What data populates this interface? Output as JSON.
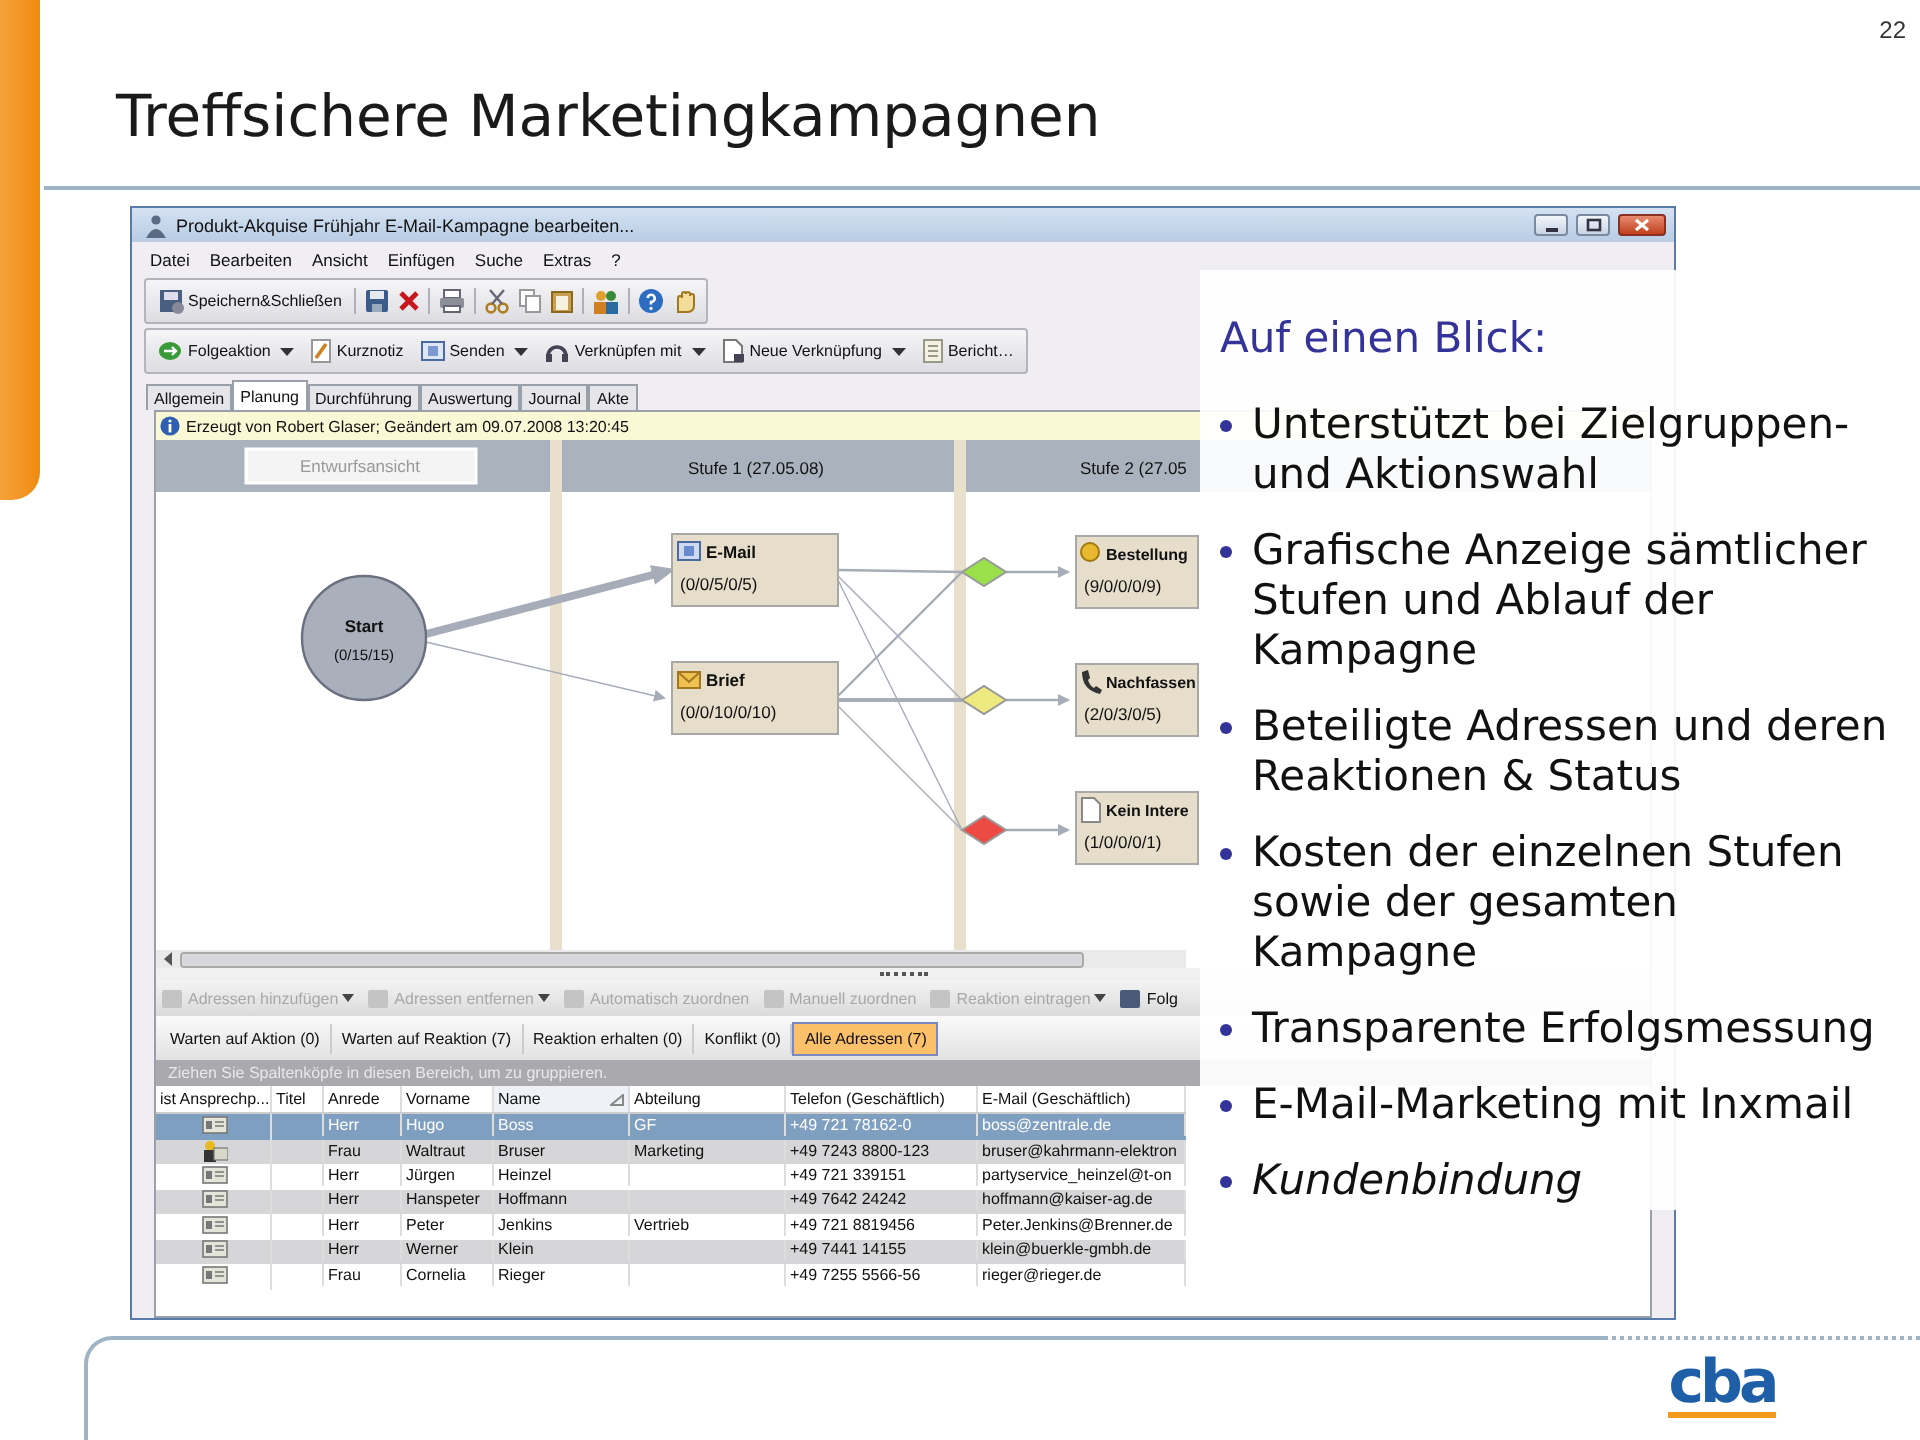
{
  "slide": {
    "page_number": "22",
    "title": "Treffsichere Marketingkampagnen",
    "logo": "cba"
  },
  "window": {
    "title": "Produkt-Akquise Frühjahr E-Mail-Kampagne bearbeiten..."
  },
  "menu": [
    "Datei",
    "Bearbeiten",
    "Ansicht",
    "Einfügen",
    "Suche",
    "Extras",
    "?"
  ],
  "toolbar": {
    "save_label": "Speichern&Schließen"
  },
  "toolbar_2": [
    {
      "label": "Folgeaktion",
      "dropdown": true
    },
    {
      "label": "Kurznotiz",
      "dropdown": false
    },
    {
      "label": "Senden",
      "dropdown": true
    },
    {
      "label": "Verknüpfen mit",
      "dropdown": true
    },
    {
      "label": "Neue Verknüpfung",
      "dropdown": true
    },
    {
      "label": "Bericht…",
      "dropdown": false
    }
  ],
  "tabs": [
    {
      "label": "Allgemein",
      "selected": false
    },
    {
      "label": "Planung",
      "selected": true
    },
    {
      "label": "Durchführung",
      "selected": false
    },
    {
      "label": "Auswertung",
      "selected": false
    },
    {
      "label": "Journal",
      "selected": false
    },
    {
      "label": "Akte",
      "selected": false
    }
  ],
  "info": "Erzeugt von Robert Glaser; Geändert am 09.07.2008 13:20:45",
  "diagram": {
    "view_button": "Entwurfsansicht",
    "stages": [
      "Stufe 1 (27.05.08)",
      "Stufe 2 (27.05"
    ],
    "start": {
      "label": "Start",
      "counts": "(0/15/15)"
    },
    "actions": [
      {
        "label": "E-Mail",
        "counts": "(0/0/5/0/5)"
      },
      {
        "label": "Brief",
        "counts": "(0/0/10/0/10)"
      }
    ],
    "decisions": [
      {
        "color": "#99e04a"
      },
      {
        "color": "#eeea80"
      },
      {
        "color": "#ee4a44"
      }
    ],
    "results": [
      {
        "label": "Bestellung",
        "counts": "(9/0/0/0/9)"
      },
      {
        "label": "Nachfassen",
        "counts": "(2/0/3/0/5)"
      },
      {
        "label": "Kein Intere",
        "counts": "(1/0/0/0/1)"
      }
    ]
  },
  "actions_bar": [
    {
      "label": "Adressen hinzufügen",
      "disabled": true,
      "dropdown": true
    },
    {
      "label": "Adressen entfernen",
      "disabled": true,
      "dropdown": true
    },
    {
      "label": "Automatisch zuordnen",
      "disabled": true,
      "dropdown": false
    },
    {
      "label": "Manuell zuordnen",
      "disabled": true,
      "dropdown": false
    },
    {
      "label": "Reaktion eintragen",
      "disabled": true,
      "dropdown": true
    },
    {
      "label": "Folg",
      "disabled": false,
      "dropdown": false
    }
  ],
  "filters": [
    {
      "label": "Warten auf Aktion (0)",
      "selected": false
    },
    {
      "label": "Warten auf Reaktion (7)",
      "selected": false
    },
    {
      "label": "Reaktion erhalten (0)",
      "selected": false
    },
    {
      "label": "Konflikt (0)",
      "selected": false
    },
    {
      "label": "Alle Adressen (7)",
      "selected": true
    }
  ],
  "group_hint": "Ziehen Sie Spaltenköpfe in diesen Bereich, um zu gruppieren.",
  "table": {
    "columns": [
      {
        "label": "ist Ansprechp...",
        "sorted": false
      },
      {
        "label": "Titel",
        "sorted": false
      },
      {
        "label": "Anrede",
        "sorted": false
      },
      {
        "label": "Vorname",
        "sorted": false
      },
      {
        "label": "Name",
        "sorted": true
      },
      {
        "label": "Abteilung",
        "sorted": false
      },
      {
        "label": "Telefon (Geschäftlich)",
        "sorted": false
      },
      {
        "label": "E-Mail (Geschäftlich)",
        "sorted": false
      }
    ],
    "rows": [
      {
        "selected": true,
        "is_contact": false,
        "anrede": "Herr",
        "vorname": "Hugo",
        "name": "Boss",
        "abteilung": "GF",
        "telefon": "+49 721 78162-0",
        "email": "boss@zentrale.de"
      },
      {
        "selected": false,
        "is_contact": true,
        "anrede": "Frau",
        "vorname": "Waltraut",
        "name": "Bruser",
        "abteilung": "Marketing",
        "telefon": "+49 7243 8800-123",
        "email": "bruser@kahrmann-elektron"
      },
      {
        "selected": false,
        "is_contact": false,
        "anrede": "Herr",
        "vorname": "Jürgen",
        "name": "Heinzel",
        "telefon": "+49 721 339151",
        "email": "partyservice_heinzel@t-on"
      },
      {
        "selected": false,
        "is_contact": false,
        "anrede": "Herr",
        "vorname": "Hanspeter",
        "name": "Hoffmann",
        "telefon": "+49 7642 24242",
        "email": "hoffmann@kaiser-ag.de"
      },
      {
        "selected": false,
        "is_contact": false,
        "anrede": "Herr",
        "vorname": "Peter",
        "name": "Jenkins",
        "abteilung": "Vertrieb",
        "telefon": "+49 721 8819456",
        "email": "Peter.Jenkins@Brenner.de"
      },
      {
        "selected": false,
        "is_contact": false,
        "anrede": "Herr",
        "vorname": "Werner",
        "name": "Klein",
        "telefon": "+49 7441 14155",
        "email": "klein@buerkle-gmbh.de"
      },
      {
        "selected": false,
        "is_contact": false,
        "anrede": "Frau",
        "vorname": "Cornelia",
        "name": "Rieger",
        "telefon": "+49 7255 5566-56",
        "email": "rieger@rieger.de"
      }
    ]
  },
  "callout": {
    "title": "Auf einen Blick:",
    "bullets": [
      {
        "text": "Unterstützt bei Zielgruppen- und Aktionswahl",
        "italic": false
      },
      {
        "text": "Grafische Anzeige sämtlicher Stufen und Ablauf der Kampagne",
        "italic": false
      },
      {
        "text": "Beteiligte Adressen und deren Reaktionen & Status",
        "italic": false
      },
      {
        "text": "Kosten der einzelnen Stufen sowie der gesamten Kampagne",
        "italic": false
      },
      {
        "text": "Transparente Erfolgsmessung",
        "italic": false
      },
      {
        "text": "E-Mail-Marketing mit Inxmail",
        "italic": false
      },
      {
        "text": "Kundenbindung",
        "italic": true
      }
    ]
  }
}
